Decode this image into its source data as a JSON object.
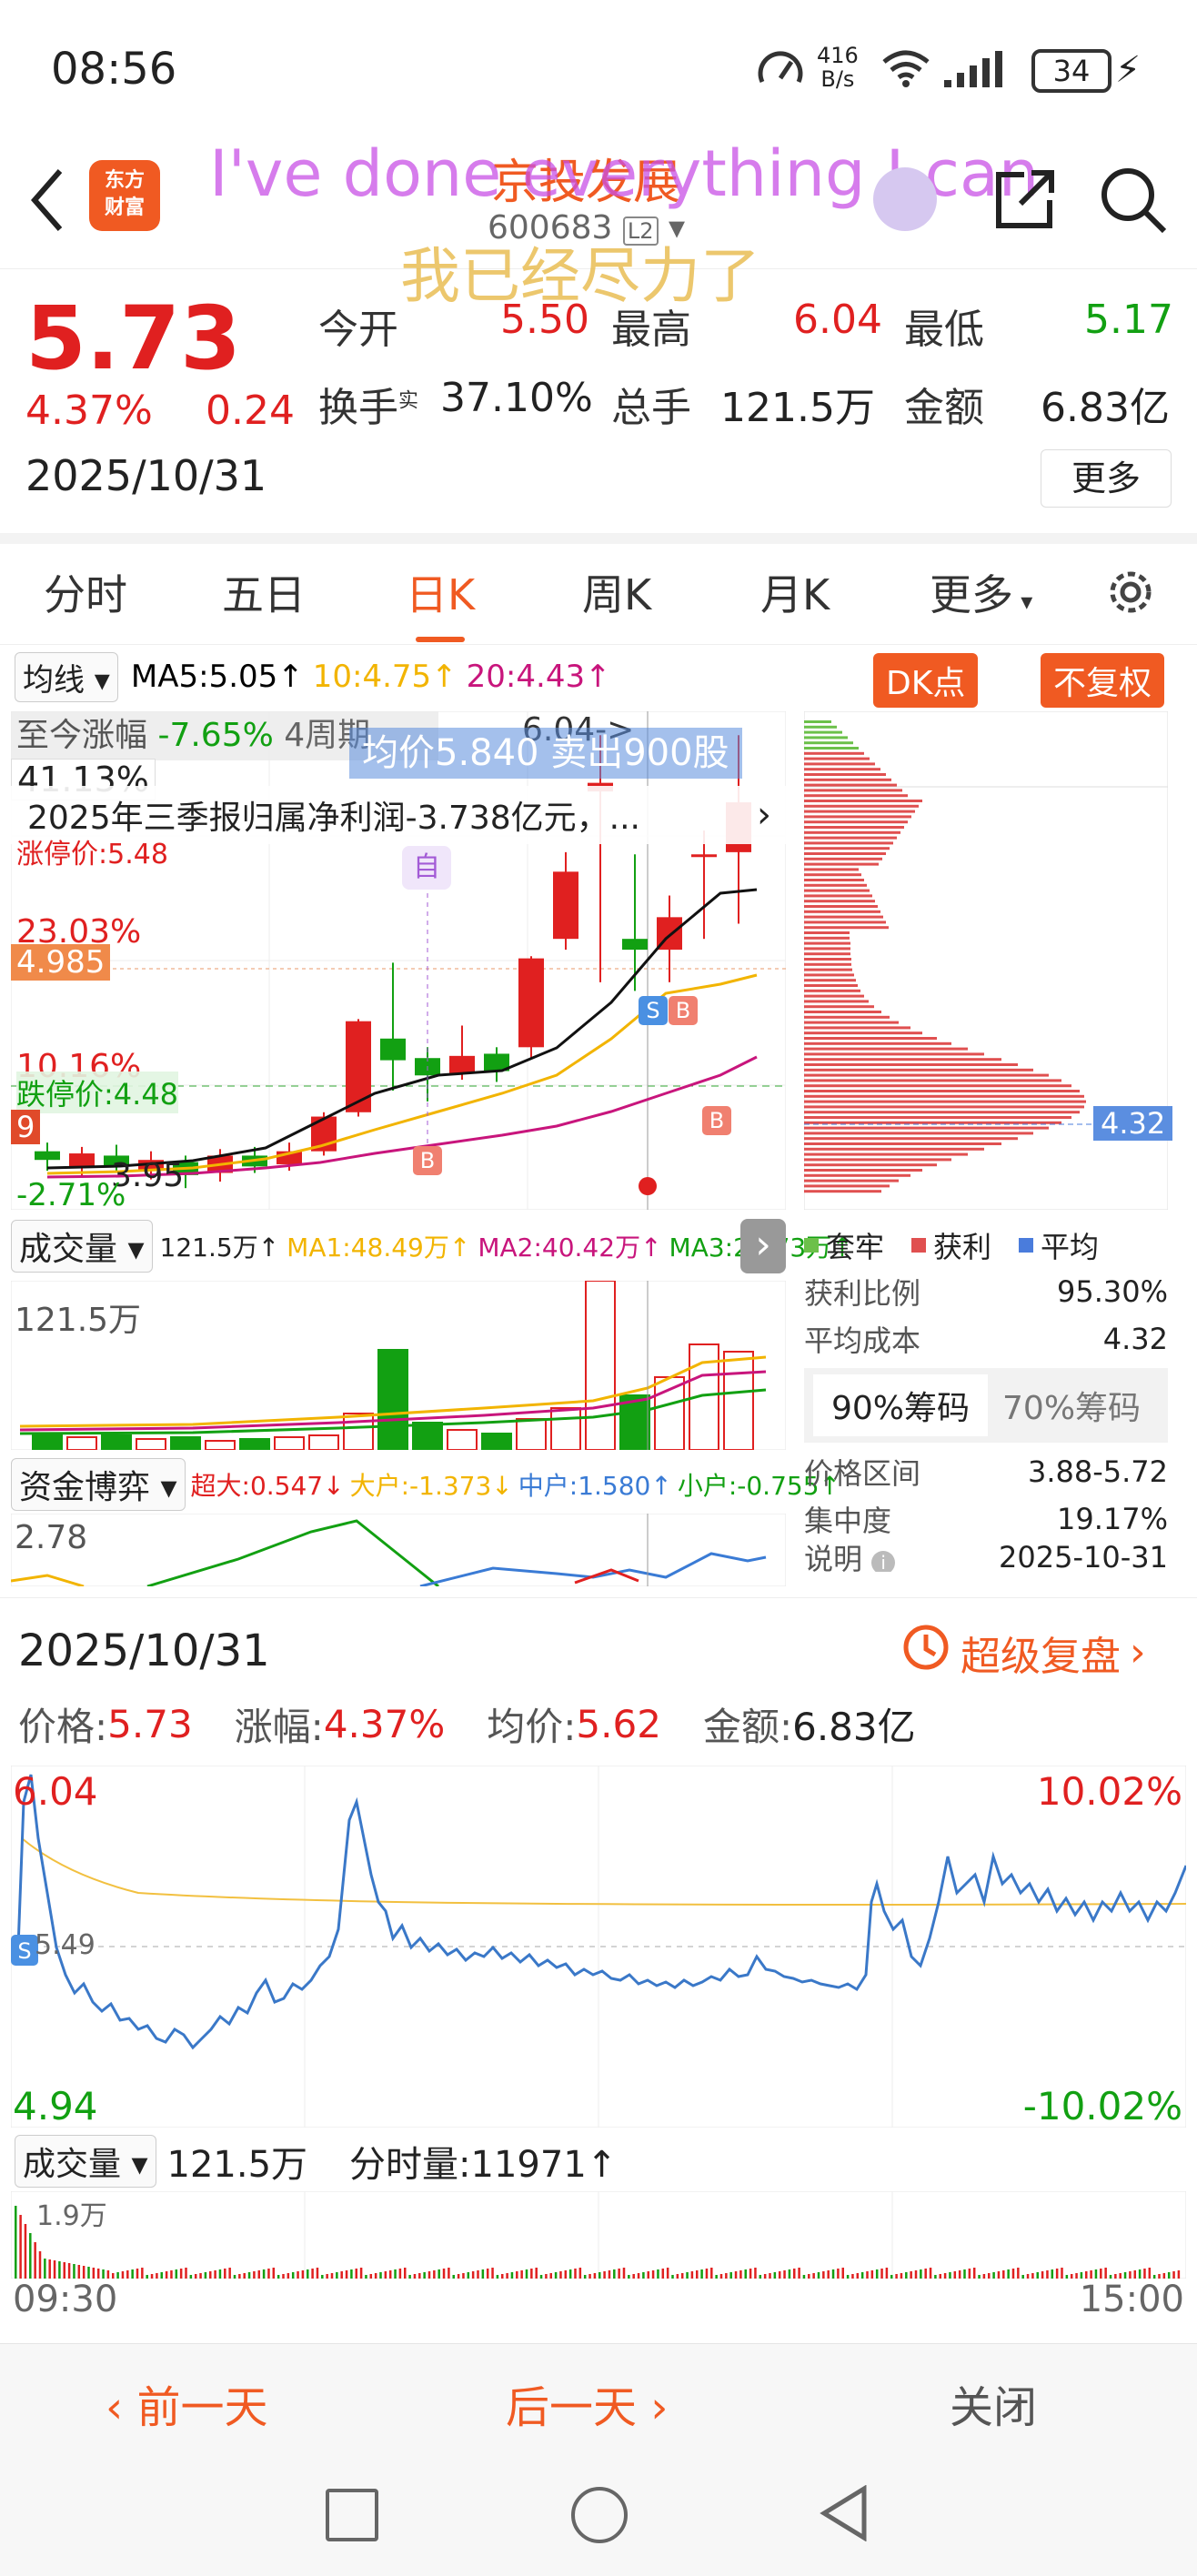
{
  "status_bar": {
    "time": "08:56",
    "net_speed_top": "416",
    "net_speed_unit": "B/s",
    "battery": "34"
  },
  "header": {
    "logo_line1": "东方",
    "logo_line2": "财富",
    "stock_name": "京投发展",
    "stock_code": "600683",
    "level_badge": "L2",
    "overlay_text_en": "I've done everything I can",
    "overlay_text_cn": "我已经尽力了"
  },
  "quote": {
    "price": "5.73",
    "change_pct": "4.37%",
    "change_amt": "0.24",
    "date": "2025/10/31",
    "open_label": "今开",
    "open": "5.50",
    "high_label": "最高",
    "high": "6.04",
    "low_label": "最低",
    "low": "5.17",
    "turnover_label": "换手",
    "turnover_sup": "实",
    "turnover": "37.10%",
    "volume_label": "总手",
    "volume": "121.5万",
    "amount_label": "金额",
    "amount": "6.83亿",
    "more_button": "更多"
  },
  "tabs": [
    {
      "label": "分时"
    },
    {
      "label": "五日"
    },
    {
      "label": "日K"
    },
    {
      "label": "周K"
    },
    {
      "label": "月K"
    },
    {
      "label": "更多"
    }
  ],
  "kline": {
    "ma_select": "均线",
    "ma5": "MA5:5.05↑",
    "ma10": "10:4.75↑",
    "ma20": "20:4.43↑",
    "dk_button": "DK点",
    "fq_button": "不复权",
    "info_label": "至今涨幅",
    "info_value": "-7.65%",
    "info_period": "4周期",
    "high_marker": "6.04->",
    "tooltip": "均价5.840 卖出900股",
    "pct_41": "41.13%",
    "news": "2025年三季报归属净利润-3.738亿元，...",
    "limit_up": "涨停价:5.48",
    "pct_23": "23.03%",
    "price_4985": "4.985",
    "pct_10": "10.16%",
    "limit_down": "跌停价:4.48",
    "tag_9": "9",
    "low_marker": "3.95",
    "pct_neg": "-2.71%",
    "self_tag": "自",
    "candles": [
      {
        "o": 4.12,
        "c": 4.08,
        "h": 4.16,
        "l": 4.03
      },
      {
        "o": 4.05,
        "c": 4.11,
        "h": 4.14,
        "l": 4.0
      },
      {
        "o": 4.1,
        "c": 4.05,
        "h": 4.15,
        "l": 4.02
      },
      {
        "o": 4.03,
        "c": 4.08,
        "h": 4.12,
        "l": 3.99
      },
      {
        "o": 4.07,
        "c": 4.01,
        "h": 4.1,
        "l": 3.95
      },
      {
        "o": 4.02,
        "c": 4.1,
        "h": 4.13,
        "l": 3.98
      },
      {
        "o": 4.1,
        "c": 4.05,
        "h": 4.14,
        "l": 4.02
      },
      {
        "o": 4.06,
        "c": 4.12,
        "h": 4.16,
        "l": 4.03
      },
      {
        "o": 4.12,
        "c": 4.28,
        "h": 4.3,
        "l": 4.1
      },
      {
        "o": 4.3,
        "c": 4.72,
        "h": 4.73,
        "l": 4.28
      },
      {
        "o": 4.64,
        "c": 4.54,
        "h": 4.99,
        "l": 4.4
      },
      {
        "o": 4.55,
        "c": 4.47,
        "h": 4.6,
        "l": 4.35
      },
      {
        "o": 4.48,
        "c": 4.56,
        "h": 4.7,
        "l": 4.45
      },
      {
        "o": 4.57,
        "c": 4.49,
        "h": 4.6,
        "l": 4.44
      },
      {
        "o": 4.6,
        "c": 5.01,
        "h": 5.02,
        "l": 4.55
      },
      {
        "o": 5.1,
        "c": 5.41,
        "h": 5.5,
        "l": 5.05
      },
      {
        "o": 5.78,
        "c": 5.82,
        "h": 6.04,
        "l": 4.9
      },
      {
        "o": 5.1,
        "c": 5.05,
        "h": 5.49,
        "l": 4.86
      },
      {
        "o": 5.05,
        "c": 5.2,
        "h": 5.3,
        "l": 4.9
      },
      {
        "o": 5.49,
        "c": 5.49,
        "h": 5.6,
        "l": 5.1
      },
      {
        "o": 5.5,
        "c": 5.73,
        "h": 6.04,
        "l": 5.17
      }
    ],
    "chips_price": "4.32"
  },
  "volume_panel": {
    "select": "成交量",
    "total": "121.5万↑",
    "ma1": "MA1:48.49万↑",
    "ma2": "MA2:40.42万↑",
    "ma3": "MA3:26.73万↑",
    "axis_max": "121.5万"
  },
  "fund_panel": {
    "select": "资金博弈",
    "super": "超大:0.547↓",
    "big": "大户:-1.373↓",
    "mid": "中户:1.580↑",
    "small": "小户:-0.755↑",
    "axis_top": "2.78"
  },
  "chips": {
    "legend_trapped": "套牢",
    "legend_profit": "获利",
    "legend_avg": "平均",
    "profit_ratio_label": "获利比例",
    "profit_ratio": "95.30%",
    "avg_cost_label": "平均成本",
    "avg_cost": "4.32",
    "tab90": "90%筹码",
    "tab70": "70%筹码",
    "range_label": "价格区间",
    "range": "3.88-5.72",
    "concentration_label": "集中度",
    "concentration": "19.17%",
    "note_label": "说明",
    "note_date": "2025-10-31"
  },
  "intraday": {
    "date": "2025/10/31",
    "replay": "超级复盘",
    "price_label": "价格:",
    "price": "5.73",
    "chg_label": "涨幅:",
    "chg": "4.37%",
    "avg_label": "均价:",
    "avg": "5.62",
    "amt_label": "金额:",
    "amt": "6.83亿",
    "top_price": "6.04",
    "top_pct": "10.02%",
    "bottom_price": "4.94",
    "bottom_pct": "-10.02%",
    "mid_price": "5.49",
    "vol_select": "成交量",
    "vol_total": "121.5万",
    "vol_tick": "分时量:11971↑",
    "vol_axis": "1.9万",
    "time_start": "09:30",
    "time_end": "15:00"
  },
  "footer": {
    "prev": "前一天",
    "next": "后一天",
    "close": "关闭"
  },
  "colors": {
    "accent": "#f05a22",
    "up": "#e02020",
    "down": "#12a012",
    "ma5": "#000000",
    "ma10": "#f2b400",
    "ma20": "#c8157c"
  }
}
